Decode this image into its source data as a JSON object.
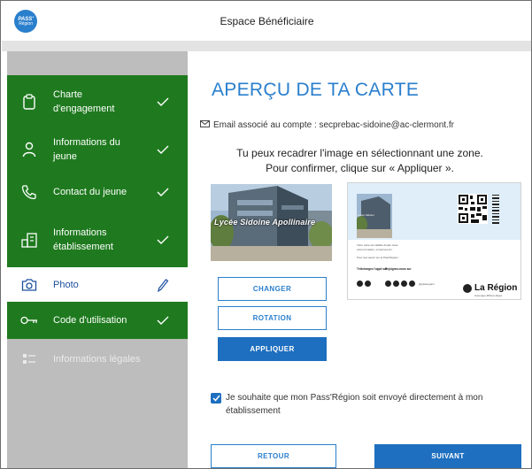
{
  "header": {
    "title": "Espace Bénéficiaire",
    "logo_line1": "PASS'",
    "logo_line2": "Région"
  },
  "sidebar": {
    "items": [
      {
        "label": "Charte d'engagement",
        "icon": "clipboard-icon",
        "state": "done"
      },
      {
        "label": "Informations du jeune",
        "icon": "user-icon",
        "state": "done"
      },
      {
        "label": "Contact du jeune",
        "icon": "phone-icon",
        "state": "done"
      },
      {
        "label": "Informations établissement",
        "icon": "building-icon",
        "state": "done"
      },
      {
        "label": "Photo",
        "icon": "camera-icon",
        "state": "active"
      },
      {
        "label": "Code d'utilisation",
        "icon": "key-icon",
        "state": "done"
      },
      {
        "label": "Informations légales",
        "icon": "list-icon",
        "state": "pending"
      }
    ]
  },
  "main": {
    "title": "APERÇU DE TA CARTE",
    "email_label": "Email associé au compte : secprebac-sidoine@ac-clermont.fr",
    "instruction_line1": "Tu peux recadrer l'image en sélectionnant une zone.",
    "instruction_line2": "Pour confirmer, clique sur « Appliquer ».",
    "photo_caption": "Lycée Sidoine Apollinaire",
    "buttons": {
      "change": "CHANGER",
      "rotate": "ROTATION",
      "apply": "APPLIQUER",
      "back": "RETOUR",
      "next": "SUIVANT"
    },
    "consent_text": "Je souhaite que mon Pass'Région soit envoyé directement à mon établissement",
    "consent_checked": true
  },
  "card_preview": {
    "photo_caption": "Lycée Sidoine",
    "lines": [
      "Votre carte est valable durant toute",
      "votre formation, conservez-la !",
      "Pour tout savoir sur le Pass'Région :"
    ],
    "download_label": "Téléchargez l'appli sur",
    "follow_label": "Rejoignez-nous sur",
    "social_handle": "@passregion",
    "region_name": "La Région",
    "region_sub": "Auvergne-Rhône-Alpes"
  },
  "colors": {
    "sidebar_green": "#1f7a1f",
    "accent_blue": "#2a7fcd",
    "button_blue": "#1e6fbf",
    "sidebar_grey": "#bdbdbd"
  }
}
